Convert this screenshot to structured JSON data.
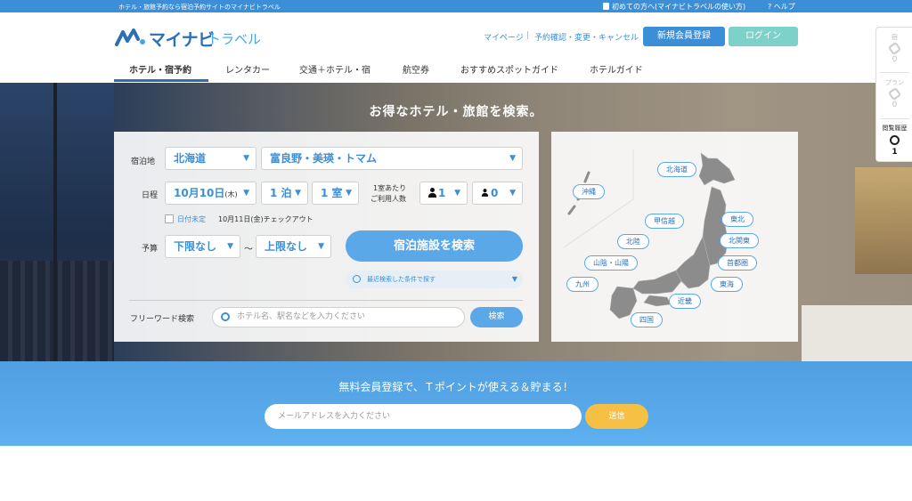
{
  "topbar": {
    "tagline": "ホテル・旅館予約なら宿泊予約サイトのマイナビトラベル",
    "first_time": "初めての方へ(マイナビトラベルの使い方)",
    "help": "? ヘルプ"
  },
  "header": {
    "logo_main": "マイナビ",
    "logo_sub": "トラベル",
    "mypage": "マイページ",
    "separator": "|",
    "reservation": "予約確認・変更・キャンセル",
    "register": "新規会員登録",
    "login": "ログイン"
  },
  "nav": {
    "items": [
      "ホテル・宿予約",
      "レンタカー",
      "交通＋ホテル・宿",
      "航空券",
      "おすすめスポットガイド",
      "ホテルガイド"
    ]
  },
  "hero": {
    "title": "お得なホテル・旅館を検索。"
  },
  "search": {
    "area_label": "宿泊地",
    "prefecture": "北海道",
    "area": "富良野・美瑛・トマム",
    "date_label": "日程",
    "date": "10月10日",
    "weekday": "(木)",
    "nights": "1 泊",
    "rooms": "1 室",
    "guests_label_1": "1室あたり",
    "guests_label_2": "ご利用人数",
    "adults": "1",
    "children": "0",
    "date_undecided": "日付未定",
    "checkout": "10月11日(金)チェックアウト",
    "budget_label": "予算",
    "budget_min": "下限なし",
    "budget_sep": "～",
    "budget_max": "上限なし",
    "submit": "宿泊施設を検索",
    "recent": "最近検索した条件で探す",
    "freeword_label": "フリーワード検索",
    "freeword_placeholder": "ホテル名、駅名などを入力ください",
    "freeword_submit": "検索"
  },
  "map": {
    "regions": [
      "北海道",
      "沖縄",
      "甲信越",
      "東北",
      "北陸",
      "北関東",
      "山陰・山陽",
      "首都圏",
      "九州",
      "東海",
      "近畿",
      "四国"
    ]
  },
  "side_widget": {
    "inn_label": "宿",
    "inn_count": "0",
    "plan_label": "プラン",
    "plan_count": "0",
    "history_label": "閲覧履歴",
    "history_count": "1"
  },
  "member": {
    "title": "無料会員登録で、Ｔポイントが使える＆貯まる！",
    "email_placeholder": "メールアドレスを入力ください",
    "send": "送信"
  },
  "colors": {
    "primary": "#3c8fd6",
    "login": "#7ed1c9",
    "send": "#f5c044",
    "map_land": "#8c8c8c"
  }
}
